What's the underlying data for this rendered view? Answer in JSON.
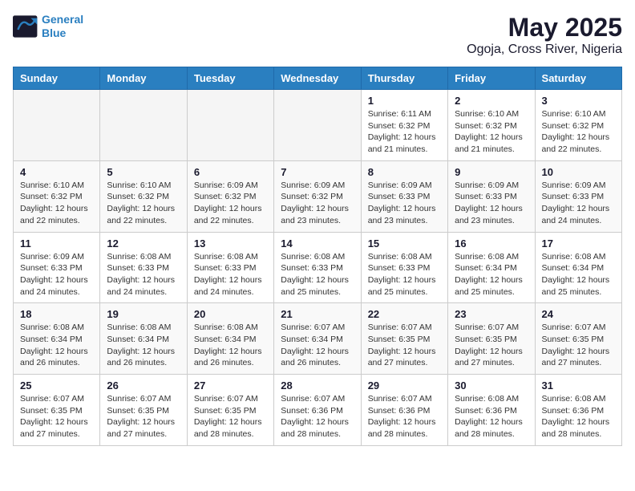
{
  "logo": {
    "line1": "General",
    "line2": "Blue"
  },
  "title": "May 2025",
  "subtitle": "Ogoja, Cross River, Nigeria",
  "weekdays": [
    "Sunday",
    "Monday",
    "Tuesday",
    "Wednesday",
    "Thursday",
    "Friday",
    "Saturday"
  ],
  "weeks": [
    [
      {
        "day": "",
        "info": ""
      },
      {
        "day": "",
        "info": ""
      },
      {
        "day": "",
        "info": ""
      },
      {
        "day": "",
        "info": ""
      },
      {
        "day": "1",
        "info": "Sunrise: 6:11 AM\nSunset: 6:32 PM\nDaylight: 12 hours\nand 21 minutes."
      },
      {
        "day": "2",
        "info": "Sunrise: 6:10 AM\nSunset: 6:32 PM\nDaylight: 12 hours\nand 21 minutes."
      },
      {
        "day": "3",
        "info": "Sunrise: 6:10 AM\nSunset: 6:32 PM\nDaylight: 12 hours\nand 22 minutes."
      }
    ],
    [
      {
        "day": "4",
        "info": "Sunrise: 6:10 AM\nSunset: 6:32 PM\nDaylight: 12 hours\nand 22 minutes."
      },
      {
        "day": "5",
        "info": "Sunrise: 6:10 AM\nSunset: 6:32 PM\nDaylight: 12 hours\nand 22 minutes."
      },
      {
        "day": "6",
        "info": "Sunrise: 6:09 AM\nSunset: 6:32 PM\nDaylight: 12 hours\nand 22 minutes."
      },
      {
        "day": "7",
        "info": "Sunrise: 6:09 AM\nSunset: 6:32 PM\nDaylight: 12 hours\nand 23 minutes."
      },
      {
        "day": "8",
        "info": "Sunrise: 6:09 AM\nSunset: 6:33 PM\nDaylight: 12 hours\nand 23 minutes."
      },
      {
        "day": "9",
        "info": "Sunrise: 6:09 AM\nSunset: 6:33 PM\nDaylight: 12 hours\nand 23 minutes."
      },
      {
        "day": "10",
        "info": "Sunrise: 6:09 AM\nSunset: 6:33 PM\nDaylight: 12 hours\nand 24 minutes."
      }
    ],
    [
      {
        "day": "11",
        "info": "Sunrise: 6:09 AM\nSunset: 6:33 PM\nDaylight: 12 hours\nand 24 minutes."
      },
      {
        "day": "12",
        "info": "Sunrise: 6:08 AM\nSunset: 6:33 PM\nDaylight: 12 hours\nand 24 minutes."
      },
      {
        "day": "13",
        "info": "Sunrise: 6:08 AM\nSunset: 6:33 PM\nDaylight: 12 hours\nand 24 minutes."
      },
      {
        "day": "14",
        "info": "Sunrise: 6:08 AM\nSunset: 6:33 PM\nDaylight: 12 hours\nand 25 minutes."
      },
      {
        "day": "15",
        "info": "Sunrise: 6:08 AM\nSunset: 6:33 PM\nDaylight: 12 hours\nand 25 minutes."
      },
      {
        "day": "16",
        "info": "Sunrise: 6:08 AM\nSunset: 6:34 PM\nDaylight: 12 hours\nand 25 minutes."
      },
      {
        "day": "17",
        "info": "Sunrise: 6:08 AM\nSunset: 6:34 PM\nDaylight: 12 hours\nand 25 minutes."
      }
    ],
    [
      {
        "day": "18",
        "info": "Sunrise: 6:08 AM\nSunset: 6:34 PM\nDaylight: 12 hours\nand 26 minutes."
      },
      {
        "day": "19",
        "info": "Sunrise: 6:08 AM\nSunset: 6:34 PM\nDaylight: 12 hours\nand 26 minutes."
      },
      {
        "day": "20",
        "info": "Sunrise: 6:08 AM\nSunset: 6:34 PM\nDaylight: 12 hours\nand 26 minutes."
      },
      {
        "day": "21",
        "info": "Sunrise: 6:07 AM\nSunset: 6:34 PM\nDaylight: 12 hours\nand 26 minutes."
      },
      {
        "day": "22",
        "info": "Sunrise: 6:07 AM\nSunset: 6:35 PM\nDaylight: 12 hours\nand 27 minutes."
      },
      {
        "day": "23",
        "info": "Sunrise: 6:07 AM\nSunset: 6:35 PM\nDaylight: 12 hours\nand 27 minutes."
      },
      {
        "day": "24",
        "info": "Sunrise: 6:07 AM\nSunset: 6:35 PM\nDaylight: 12 hours\nand 27 minutes."
      }
    ],
    [
      {
        "day": "25",
        "info": "Sunrise: 6:07 AM\nSunset: 6:35 PM\nDaylight: 12 hours\nand 27 minutes."
      },
      {
        "day": "26",
        "info": "Sunrise: 6:07 AM\nSunset: 6:35 PM\nDaylight: 12 hours\nand 27 minutes."
      },
      {
        "day": "27",
        "info": "Sunrise: 6:07 AM\nSunset: 6:35 PM\nDaylight: 12 hours\nand 28 minutes."
      },
      {
        "day": "28",
        "info": "Sunrise: 6:07 AM\nSunset: 6:36 PM\nDaylight: 12 hours\nand 28 minutes."
      },
      {
        "day": "29",
        "info": "Sunrise: 6:07 AM\nSunset: 6:36 PM\nDaylight: 12 hours\nand 28 minutes."
      },
      {
        "day": "30",
        "info": "Sunrise: 6:08 AM\nSunset: 6:36 PM\nDaylight: 12 hours\nand 28 minutes."
      },
      {
        "day": "31",
        "info": "Sunrise: 6:08 AM\nSunset: 6:36 PM\nDaylight: 12 hours\nand 28 minutes."
      }
    ]
  ]
}
